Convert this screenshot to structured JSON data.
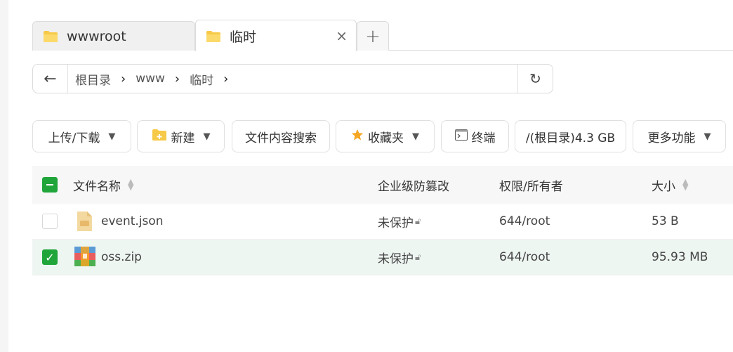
{
  "tabs": [
    {
      "label": "wwwroot",
      "active": false
    },
    {
      "label": "临时",
      "active": true
    }
  ],
  "tab_add_label": "+",
  "tab_close_label": "×",
  "path": {
    "back_label": "←",
    "crumbs": [
      "根目录",
      "www",
      "临时"
    ],
    "separator": "›",
    "refresh_label": "↻"
  },
  "toolbar": {
    "upload_download": "上传/下载",
    "new": "新建",
    "content_search": "文件内容搜索",
    "favorites": "收藏夹",
    "terminal": "终端",
    "disk": "/(根目录)4.3 GB",
    "more": "更多功能"
  },
  "table": {
    "headers": {
      "name": "文件名称",
      "tamper": "企业级防篡改",
      "perm": "权限/所有者",
      "size": "大小"
    },
    "rows": [
      {
        "name": "event.json",
        "tamper": "未保护",
        "perm": "644/root",
        "size": "53 B",
        "checked": false,
        "icon": "json-file-icon"
      },
      {
        "name": "oss.zip",
        "tamper": "未保护",
        "perm": "644/root",
        "size": "95.93 MB",
        "checked": true,
        "icon": "zip-file-icon"
      }
    ]
  },
  "colors": {
    "accent": "#20a53a",
    "folder": "#f7c948",
    "selected_row": "#eef6f2"
  }
}
